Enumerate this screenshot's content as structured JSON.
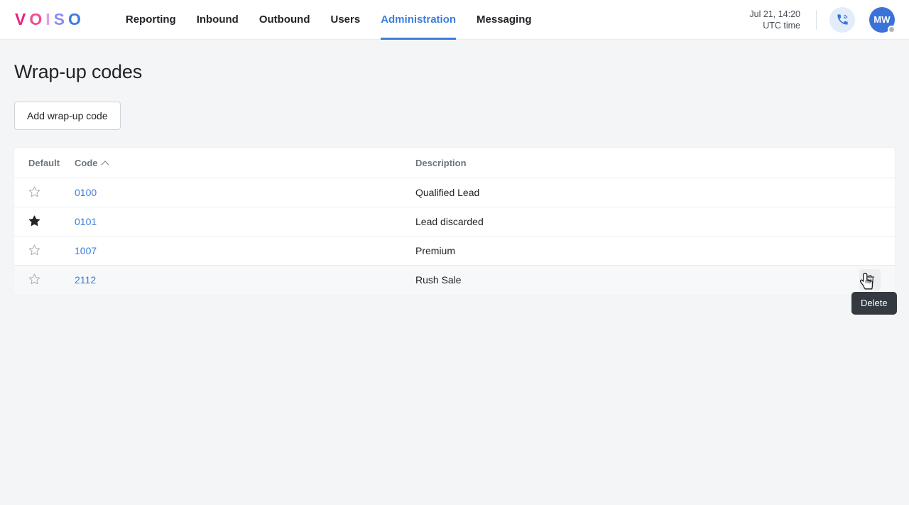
{
  "brand": {
    "name": "VOISO",
    "letters": [
      {
        "char": "V",
        "color": "#ec1f7f"
      },
      {
        "char": "O",
        "color": "#ef4d93"
      },
      {
        "char": "I",
        "color": "#e59ee0"
      },
      {
        "char": "S",
        "color": "#8a8ef0"
      },
      {
        "char": "O",
        "color": "#3b7ddd"
      }
    ]
  },
  "nav": {
    "items": [
      {
        "label": "Reporting",
        "active": false
      },
      {
        "label": "Inbound",
        "active": false
      },
      {
        "label": "Outbound",
        "active": false
      },
      {
        "label": "Users",
        "active": false
      },
      {
        "label": "Administration",
        "active": true
      },
      {
        "label": "Messaging",
        "active": false
      }
    ],
    "active_color": "#3b7ddd"
  },
  "header_right": {
    "clock_date": "Jul 21, 14:20",
    "clock_zone": "UTC time",
    "phone_icon": "phone-call-icon",
    "avatar_initials": "MW",
    "avatar_color": "#3b72d9",
    "status_color": "#adb5bd"
  },
  "page": {
    "title": "Wrap-up codes",
    "add_button": "Add wrap-up code"
  },
  "table": {
    "columns": [
      {
        "key": "default",
        "label": "Default",
        "sorted": false
      },
      {
        "key": "code",
        "label": "Code",
        "sorted": true,
        "sort_dir": "asc"
      },
      {
        "key": "description",
        "label": "Description",
        "sorted": false
      },
      {
        "key": "actions",
        "label": "",
        "sorted": false
      }
    ],
    "rows": [
      {
        "default": false,
        "code": "0100",
        "description": "Qualified Lead",
        "hovered": false
      },
      {
        "default": true,
        "code": "0101",
        "description": "Lead discarded",
        "hovered": false
      },
      {
        "default": false,
        "code": "1007",
        "description": "Premium",
        "hovered": false
      },
      {
        "default": false,
        "code": "2112",
        "description": "Rush Sale",
        "hovered": true
      }
    ],
    "link_color": "#3b7ddd",
    "star_filled_color": "#212529",
    "star_empty_color": "#adb5bd"
  },
  "row_actions": {
    "delete_icon": "trash-icon",
    "delete_tooltip": "Delete"
  }
}
